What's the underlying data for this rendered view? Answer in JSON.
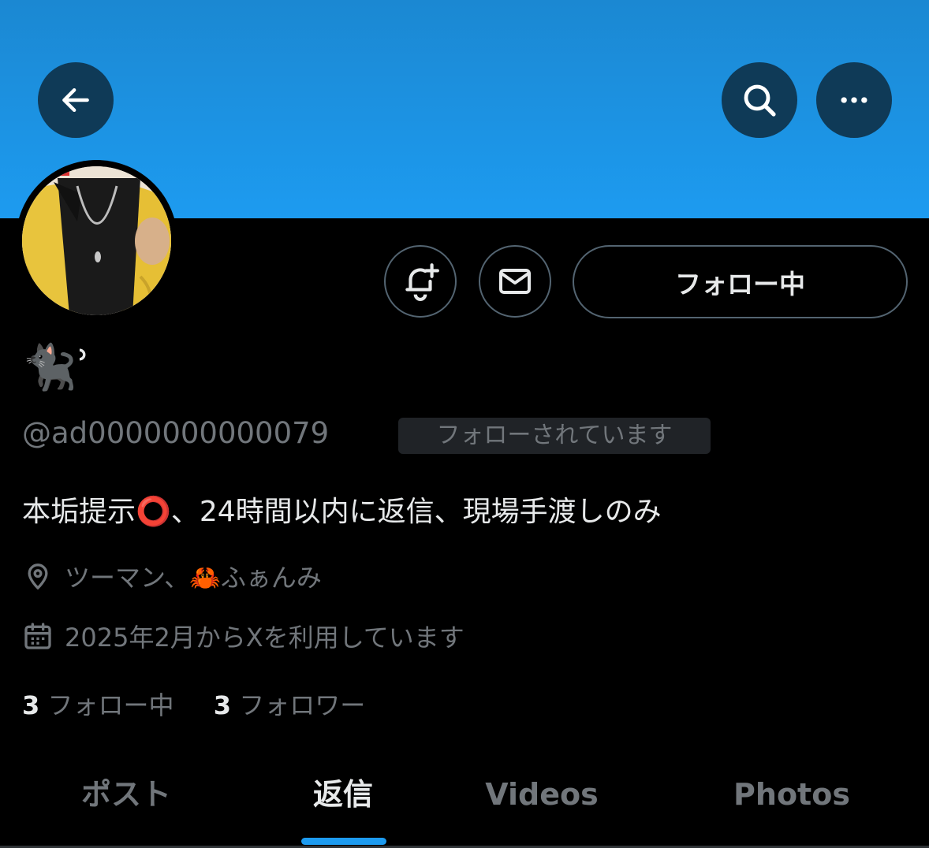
{
  "header": {
    "back_icon": "arrow-left-icon",
    "search_icon": "search-icon",
    "more_icon": "more-dots-icon",
    "banner_color": "#1d9bf0"
  },
  "profile": {
    "display_name": "🐈‍⬛ʾ",
    "handle": "@ad0000000000079",
    "follows_you_badge": "フォローされています",
    "bio": "本垢提示⭕️、24時間以内に返信、現場手渡しのみ",
    "location": "ツーマン、🦀ふぁんみ",
    "joined": "2025年2月からXを利用しています"
  },
  "actions": {
    "notify_icon": "bell-plus-icon",
    "message_icon": "envelope-icon",
    "follow_label": "フォロー中"
  },
  "stats": {
    "following_count": "3",
    "following_label": "フォロー中",
    "followers_count": "3",
    "followers_label": "フォロワー"
  },
  "tabs": [
    {
      "label": "ポスト",
      "active": false
    },
    {
      "label": "返信",
      "active": true
    },
    {
      "label": "Videos",
      "active": false
    },
    {
      "label": "Photos",
      "active": false
    }
  ],
  "colors": {
    "background": "#000000",
    "accent": "#1d9bf0",
    "text_primary": "#e7e9ea",
    "text_secondary": "#71767b"
  }
}
